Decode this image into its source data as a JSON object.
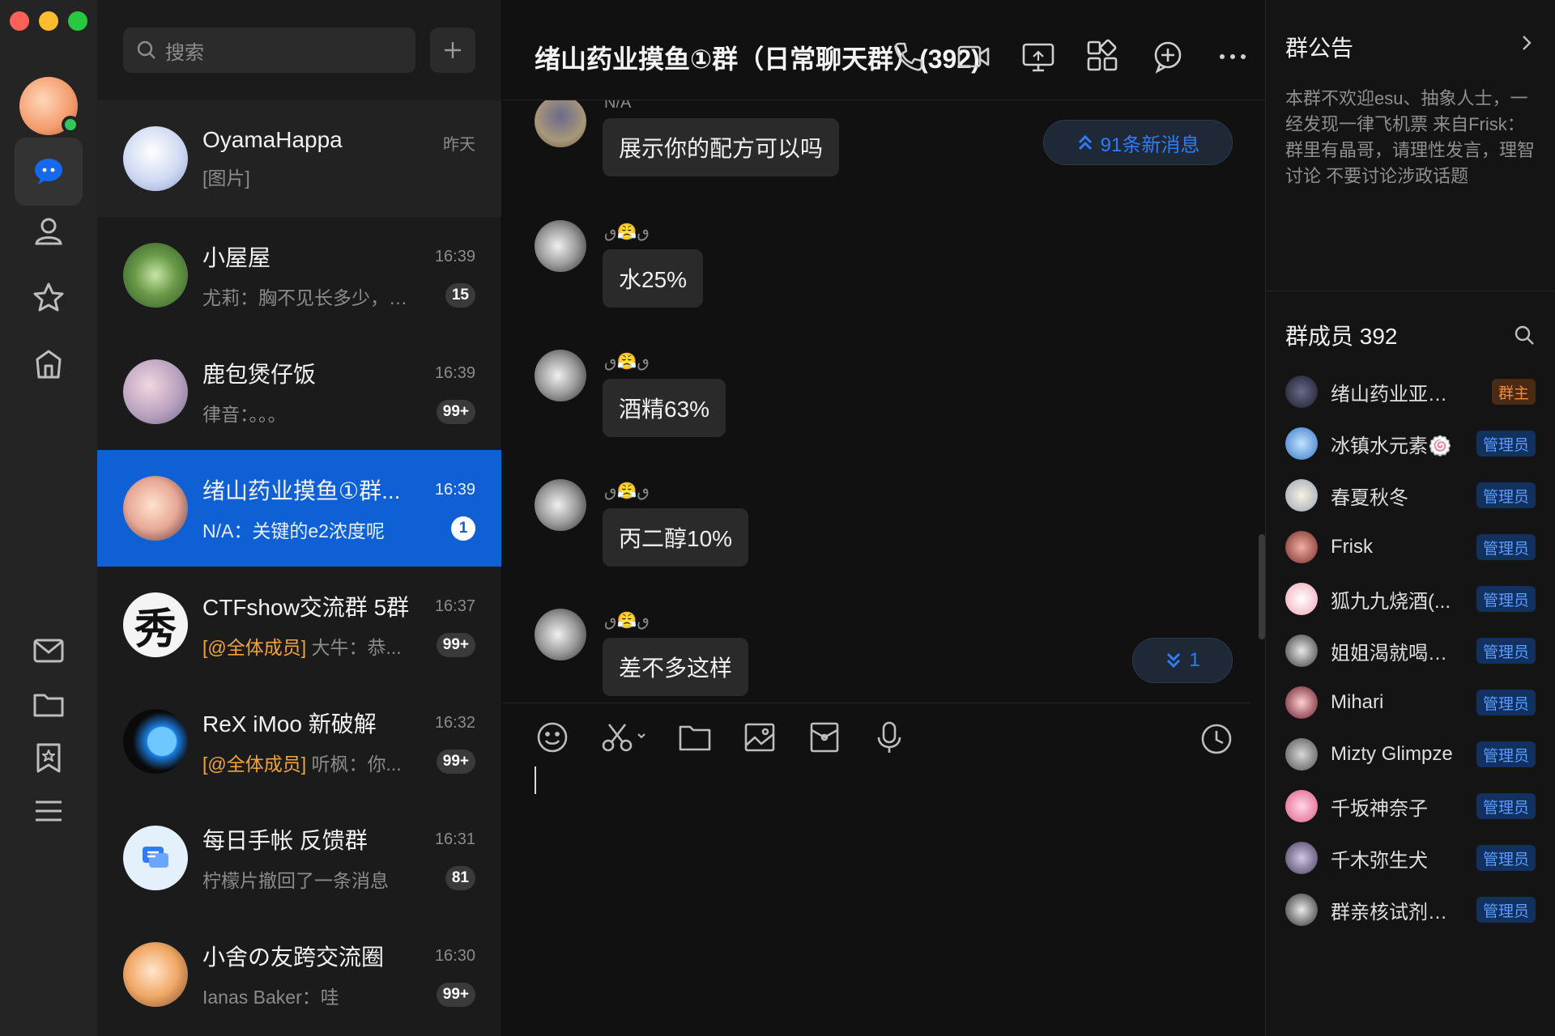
{
  "colors": {
    "accent": "#0f5fd5",
    "link": "#2f7cf6",
    "owner": "#f48b38",
    "at": "#f2a43a",
    "online": "#31c75a"
  },
  "rail": {
    "items": [
      {
        "icon": "chat-bubble-icon",
        "active": true
      },
      {
        "icon": "contact-icon"
      },
      {
        "icon": "star-icon"
      },
      {
        "icon": "explore-icon"
      },
      {
        "icon": "mail-icon"
      },
      {
        "icon": "folder-icon"
      },
      {
        "icon": "bookmark-icon"
      },
      {
        "icon": "menu-icon"
      }
    ]
  },
  "list": {
    "search_placeholder": "搜索",
    "conversations": [
      {
        "name": "OyamaHappa",
        "preview": "[图片]",
        "time": "昨天",
        "badge": ""
      },
      {
        "name": "小屋屋",
        "preview": "尤莉：胸不见长多少，…",
        "time": "16:39",
        "badge": "15"
      },
      {
        "name": "鹿包煲仔饭",
        "preview": "律音：。。。",
        "time": "16:39",
        "badge": "99+"
      },
      {
        "name": "绪山药业摸鱼①群...",
        "preview": "N/A：关键的e2浓度呢",
        "time": "16:39",
        "badge": "1"
      },
      {
        "name": "CTFshow交流群 5群",
        "at": "[@全体成员]",
        "preview": " 大牛：恭...",
        "time": "16:37",
        "badge": "99+"
      },
      {
        "name": "ReX iMoo 新破解",
        "at": "[@全体成员]",
        "preview": " 听枫：你...",
        "time": "16:32",
        "badge": "99+"
      },
      {
        "name": "每日手帐 反馈群",
        "preview": "柠檬片撤回了一条消息",
        "time": "16:31",
        "badge": "81"
      },
      {
        "name": "小舍の友跨交流圈",
        "preview": "Ianas Baker：哇",
        "time": "16:30",
        "badge": "99+"
      }
    ]
  },
  "chat": {
    "title": "绪山药业摸鱼①群（日常聊天群）(392)",
    "new_messages": "91条新消息",
    "new_below": "1",
    "messages": [
      {
        "nick": "N/A",
        "text": "展示你的配方可以吗"
      },
      {
        "nick": "ٯ😤ٯ",
        "text": "水25%"
      },
      {
        "nick": "ٯ😤ٯ",
        "text": "酒精63%"
      },
      {
        "nick": "ٯ😤ٯ",
        "text": "丙二醇10%"
      },
      {
        "nick": "ٯ😤ٯ",
        "text": "差不多这样"
      }
    ]
  },
  "side": {
    "notice_title": "群公告",
    "notice_text": "本群不欢迎esu、抽象人士，一经发现一律飞机票 来自Frisk：群里有晶哥，请理性发言，理智讨论 不要讨论涉政话题",
    "members_title": "群成员 392",
    "members": [
      {
        "name": "绪山药业亚洲...",
        "role": "群主",
        "role_type": "owner"
      },
      {
        "name": "冰镇水元素🍥",
        "role": "管理员",
        "role_type": "admin"
      },
      {
        "name": "春夏秋冬",
        "role": "管理员",
        "role_type": "admin"
      },
      {
        "name": "Frisk",
        "role": "管理员",
        "role_type": "admin"
      },
      {
        "name": "狐九九烧酒(...",
        "role": "管理员",
        "role_type": "admin"
      },
      {
        "name": "姐姐渴就喝水...",
        "role": "管理员",
        "role_type": "admin"
      },
      {
        "name": "Mihari",
        "role": "管理员",
        "role_type": "admin"
      },
      {
        "name": "Mizty Glimpze",
        "role": "管理员",
        "role_type": "admin"
      },
      {
        "name": "千坂神奈子",
        "role": "管理员",
        "role_type": "admin"
      },
      {
        "name": "千木弥生犬",
        "role": "管理员",
        "role_type": "admin"
      },
      {
        "name": "群亲核试剂，...",
        "role": "管理员",
        "role_type": "admin"
      }
    ]
  }
}
